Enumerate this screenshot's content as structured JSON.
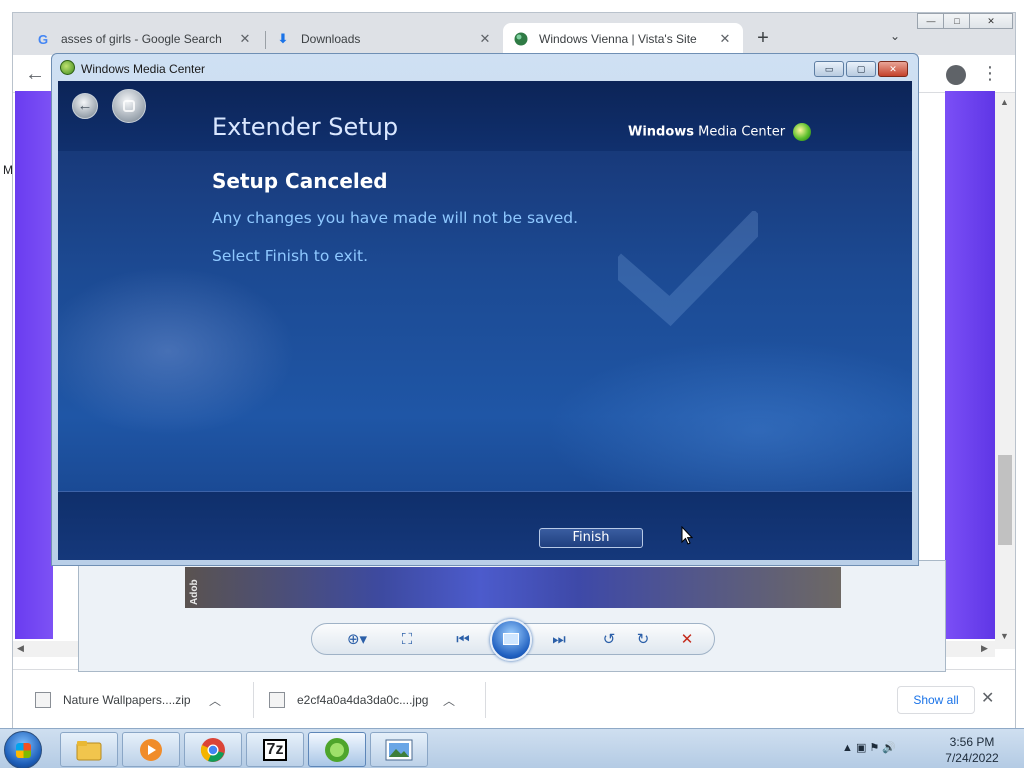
{
  "browser": {
    "tabs": [
      {
        "icon": "google-icon",
        "title": "asses of girls - Google Search",
        "close": "✕"
      },
      {
        "icon": "download-icon",
        "title": "Downloads",
        "close": "✕"
      },
      {
        "icon": "globe-icon",
        "title": "Windows Vienna | Vista's Site",
        "close": "✕"
      }
    ],
    "new_tab": "+",
    "tab_search": "⌄",
    "window_buttons": [
      "—",
      "□",
      "✕"
    ],
    "back": "←",
    "menu": "⋮",
    "left_edge_text": "M"
  },
  "photo_viewer": {
    "side_label": "Adob",
    "toolbar": [
      "zoom-icon",
      "fit-icon",
      "previous-icon",
      "slideshow-icon",
      "next-icon",
      "rotate-left-icon",
      "rotate-right-icon",
      "delete-icon"
    ],
    "zoom_glyph": "⊕▾",
    "fit_glyph": "⛶",
    "prev_glyph": "⏮",
    "next_glyph": "⏭",
    "rotl_glyph": "↺",
    "rotr_glyph": "↻",
    "delete_glyph": "✕"
  },
  "downloads_bar": {
    "items": [
      {
        "name": "Nature Wallpapers....zip",
        "chevron": "︿"
      },
      {
        "name": "e2cf4a0a4da3da0c....jpg",
        "chevron": "︿"
      }
    ],
    "show_all": "Show all",
    "close": "✕"
  },
  "wmc": {
    "window_title": "Windows Media Center",
    "controls": [
      "▭",
      "▢",
      "✕"
    ],
    "back_glyph": "←",
    "header": "Extender Setup",
    "brand_bold": "Windows",
    "brand_rest": " Media Center",
    "status_title": "Setup Canceled",
    "line1": "Any changes you have made will not be saved.",
    "line2": "Select Finish to exit.",
    "finish": "Finish"
  },
  "taskbar": {
    "apps": [
      "explorer",
      "media-player",
      "chrome",
      "7-zip",
      "media-center",
      "photo-viewer"
    ],
    "app_7zip_label": "7z",
    "tray_icons": "▲ ▣ ⚑ 🔊",
    "time": "3:56 PM",
    "date": "7/24/2022"
  },
  "colors": {
    "wmc_text_accent": "#8ec8ff",
    "wmc_bg": "#1c4a93",
    "chrome_tabstrip": "#dee1e6",
    "link_blue": "#1a73e8"
  }
}
